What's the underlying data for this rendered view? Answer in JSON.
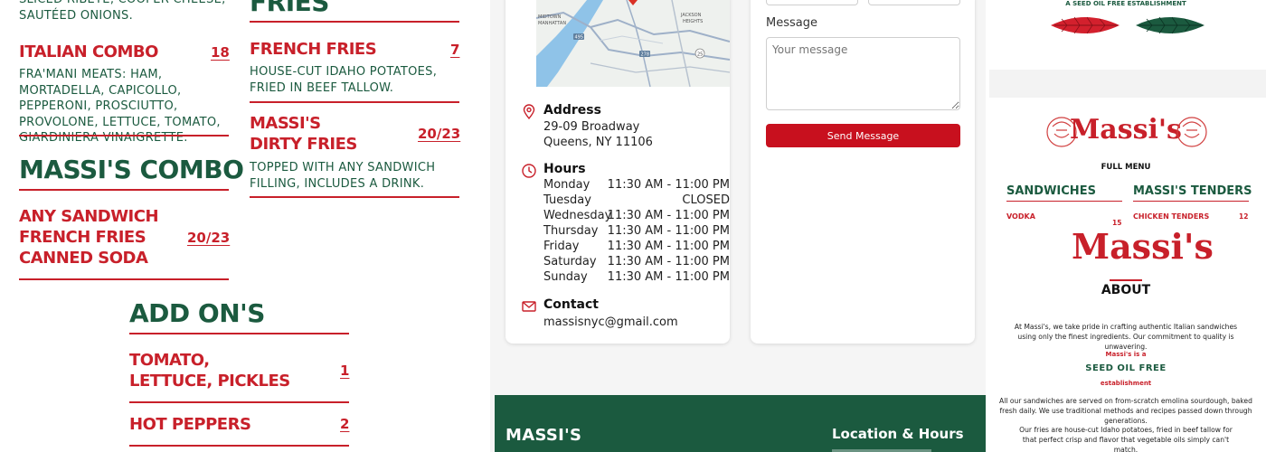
{
  "menu": {
    "top_desc": "SLICED RIBEYE, COOPER CHEESE, SAUTÉED ONIONS.",
    "top_heading_partial": "FRIES",
    "items_left": [
      {
        "name": "ITALIAN COMBO",
        "price": "18",
        "desc": "FRA'MANI MEATS: HAM, MORTADELLA, CAPICOLLO, PEPPERONI, PROSCIUTTO, PROVOLONE, LETTUCE, TOMATO, GIARDINIERA VINAIGRETTE."
      }
    ],
    "items_right": [
      {
        "name": "FRENCH FRIES",
        "price": "7",
        "desc": "HOUSE-CUT IDAHO POTATOES, FRIED IN BEEF TALLOW."
      },
      {
        "name_line1": "MASSI'S",
        "name_line2": "DIRTY FRIES",
        "price": "20/23",
        "desc": "TOPPED WITH ANY SANDWICH FILLING, INCLUDES A DRINK."
      }
    ],
    "combo": {
      "title": "MASSI'S COMBO",
      "lines": [
        "ANY SANDWICH",
        "FRENCH FRIES",
        "CANNED SODA"
      ],
      "price": "20/23"
    },
    "addons": {
      "title": "ADD ON'S",
      "items": [
        {
          "name_line1": "TOMATO,",
          "name_line2": "LETTUCE, PICKLES",
          "price": "1"
        },
        {
          "name": "HOT PEPPERS",
          "price": "2"
        }
      ]
    }
  },
  "contact": {
    "address_label": "Address",
    "address_line1": "29-09 Broadway",
    "address_line2": "Queens, NY 11106",
    "hours_label": "Hours",
    "hours": [
      {
        "day": "Monday",
        "time": "11:30 AM - 11:00 PM"
      },
      {
        "day": "Tuesday",
        "time": "CLOSED"
      },
      {
        "day": "Wednesday",
        "time": "11:30 AM - 11:00 PM"
      },
      {
        "day": "Thursday",
        "time": "11:30 AM - 11:00 PM"
      },
      {
        "day": "Friday",
        "time": "11:30 AM - 11:00 PM"
      },
      {
        "day": "Saturday",
        "time": "11:30 AM - 11:00 PM"
      },
      {
        "day": "Sunday",
        "time": "11:30 AM - 11:00 PM"
      }
    ],
    "contact_label": "Contact",
    "email": "massisnyc@gmail.com",
    "map_labels": {
      "midtown": "MIDTOWN",
      "manhattan": "MANHATTAN",
      "jackson": "JACKSON",
      "heights": "HEIGHTS",
      "route_278": "278",
      "route_495": "495",
      "route_25": "25"
    },
    "form": {
      "message_label": "Message",
      "message_placeholder": "Your message",
      "send_label": "Send Message"
    },
    "footer": {
      "brand": "MASSI'S",
      "location_heading": "Location & Hours"
    }
  },
  "mobile": {
    "establishment_tag": "A SEED OIL FREE ESTABLISHMENT",
    "logo_text": "Massi's",
    "full_menu": "FULL MENU",
    "col1_title": "SANDWICHES",
    "col1_item": "VODKA",
    "col1_price": "15",
    "col2_title": "MASSI'S TENDERS",
    "col2_item": "CHICKEN TENDERS",
    "col2_price": "12",
    "about_title": "ABOUT",
    "about_p1": "At Massi's, we take pride in crafting authentic Italian sandwiches using only the finest ingredients. Our commitment to quality is unwavering.",
    "seed_line1": "Massi's is a",
    "seed_line2": "SEED OIL FREE",
    "seed_line3": "establishment",
    "about_p2": "All our sandwiches are served on from-scratch emolina sourdough, baked fresh daily. We use traditional methods and recipes passed down through generations.",
    "about_p3": "Our fries are house-cut Idaho potatoes, fried in beef tallow for that perfect crisp and flavor that vegetable oils simply can't match."
  },
  "colors": {
    "brand_red": "#c8202a",
    "brand_green": "#1b5a3f"
  }
}
